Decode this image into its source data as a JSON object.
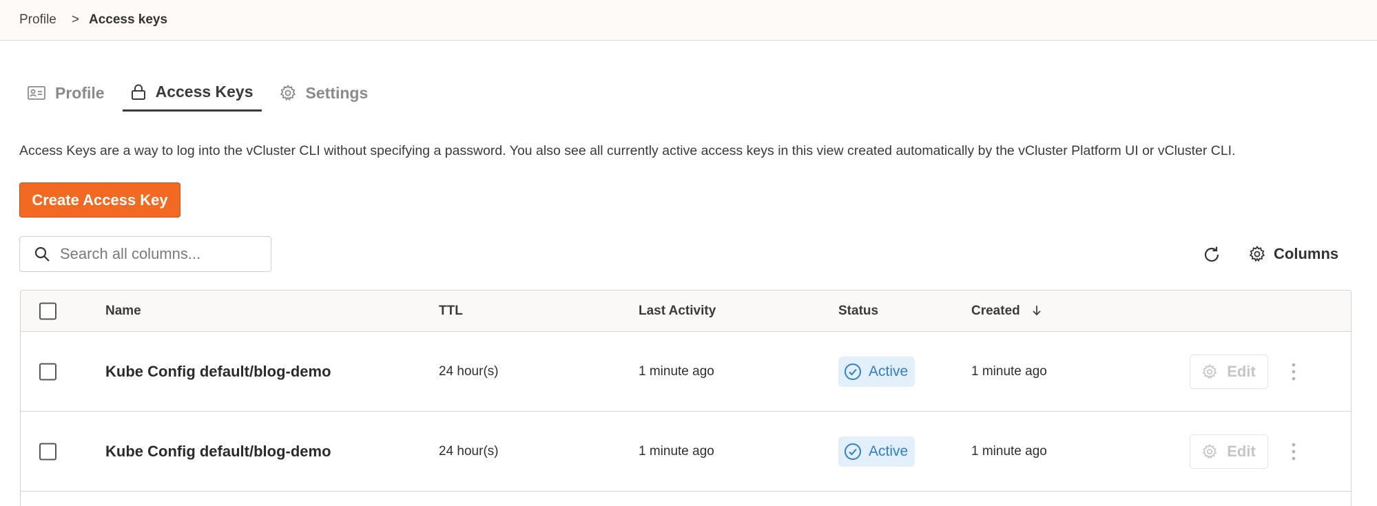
{
  "breadcrumb": {
    "root": "Profile",
    "separator": ">",
    "current": "Access keys"
  },
  "tabs": [
    {
      "label": "Profile",
      "icon": "id-card-icon",
      "active": false
    },
    {
      "label": "Access Keys",
      "icon": "lock-icon",
      "active": true
    },
    {
      "label": "Settings",
      "icon": "gear-icon",
      "active": false
    }
  ],
  "description": "Access Keys are a way to log into the vCluster CLI without specifying a password. You also see all currently active access keys in this view created automatically by the vCluster Platform UI or vCluster CLI.",
  "create_button": "Create Access Key",
  "search": {
    "placeholder": "Search all columns...",
    "value": ""
  },
  "toolbar": {
    "refresh_icon": "refresh-icon",
    "columns_label": "Columns"
  },
  "table": {
    "headers": {
      "name": "Name",
      "ttl": "TTL",
      "last_activity": "Last Activity",
      "status": "Status",
      "created": "Created"
    },
    "sort": {
      "column": "Created",
      "direction": "descending"
    },
    "rows": [
      {
        "name": "Kube Config default/blog-demo",
        "ttl": "24 hour(s)",
        "last_activity": "1 minute ago",
        "status": "Active",
        "created": "1 minute ago",
        "edit": "Edit"
      },
      {
        "name": "Kube Config default/blog-demo",
        "ttl": "24 hour(s)",
        "last_activity": "1 minute ago",
        "status": "Active",
        "created": "1 minute ago",
        "edit": "Edit"
      }
    ]
  },
  "colors": {
    "primary_button": "#f26a21",
    "status_active_bg": "#e3effb",
    "status_active_text": "#2c7fd0",
    "breadcrumb_bg": "#fdfaf7"
  }
}
